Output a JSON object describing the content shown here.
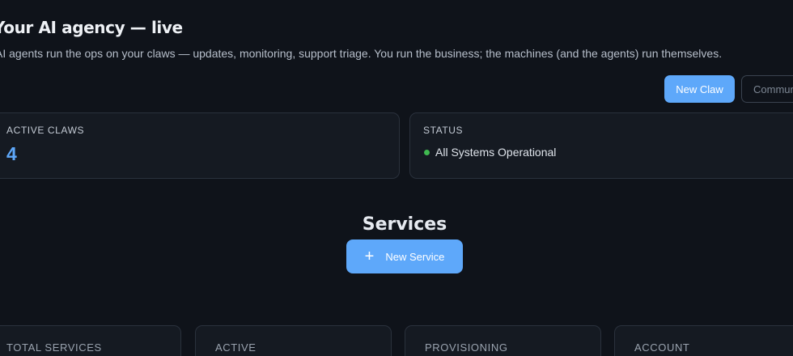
{
  "header": {
    "title": "Your AI agency — live",
    "subtitle": "AI agents run the ops on your claws — updates, monitoring, support triage. You run the business; the machines (and the agents) run themselves."
  },
  "actions": {
    "new_claw": "New Claw",
    "community": "Community"
  },
  "summary": {
    "active_claws_label": "ACTIVE CLAWS",
    "active_claws_value": "4",
    "status_label": "STATUS",
    "status_text": "All Systems Operational",
    "status_color": "#3fb950"
  },
  "services": {
    "title": "Services",
    "new_service_label": "New Service",
    "new_service_icon": "plus-icon",
    "stats": [
      {
        "label": "TOTAL SERVICES"
      },
      {
        "label": "ACTIVE"
      },
      {
        "label": "PROVISIONING"
      },
      {
        "label": "ACCOUNT"
      }
    ]
  },
  "colors": {
    "background": "#0f131a",
    "accent": "#5ea8fa",
    "card": "#151a22",
    "border": "#2a313c"
  }
}
